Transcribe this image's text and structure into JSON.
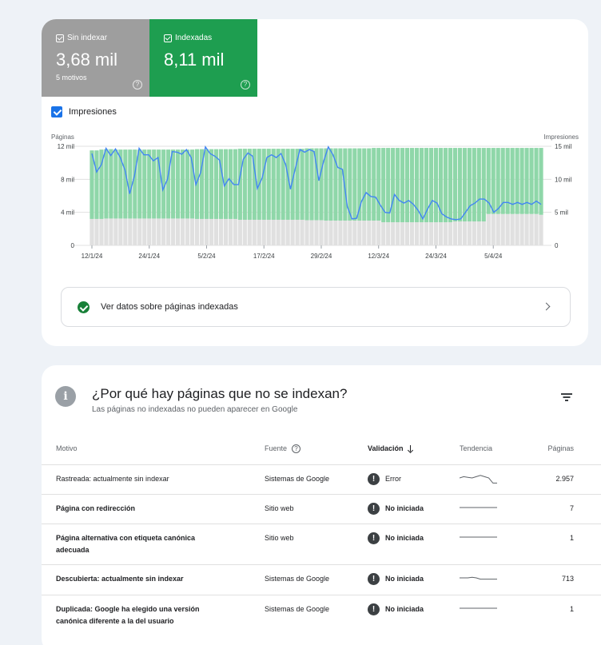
{
  "summary": {
    "not_indexed": {
      "label": "Sin indexar",
      "value": "3,68 mil",
      "sub": "5 motivos",
      "color": "#9e9e9e"
    },
    "indexed": {
      "label": "Indexadas",
      "value": "8,11 mil",
      "color": "#1e9e50"
    },
    "help_glyph": "?"
  },
  "impressions_toggle": {
    "label": "Impresiones",
    "checked": true
  },
  "chart_data": {
    "type": "bar",
    "stacked": true,
    "left_axis_label": "Páginas",
    "right_axis_label": "Impresiones",
    "left_ticks": [
      "12 mil",
      "8 mil",
      "4 mil",
      "0"
    ],
    "right_ticks": [
      "15 mil",
      "10 mil",
      "5 mil",
      "0"
    ],
    "left_ylim": [
      0,
      12000
    ],
    "right_ylim": [
      0,
      15000
    ],
    "x_tick_labels": [
      "12/1/24",
      "24/1/24",
      "5/2/24",
      "17/2/24",
      "29/2/24",
      "12/3/24",
      "24/3/24",
      "5/4/24"
    ],
    "x_tick_index": [
      0,
      12,
      24,
      36,
      48,
      60,
      72,
      84
    ],
    "grid": true,
    "series": [
      {
        "name": "Sin indexar",
        "color": "#e0e0e0",
        "values": [
          3200,
          3200,
          3200,
          3250,
          3250,
          3250,
          3250,
          3250,
          3250,
          3250,
          3250,
          3250,
          3250,
          3250,
          3250,
          3250,
          3250,
          3250,
          3250,
          3250,
          3250,
          3250,
          3200,
          3200,
          3200,
          3200,
          3200,
          3200,
          3200,
          3200,
          3200,
          3100,
          3100,
          3100,
          3100,
          3100,
          3100,
          3100,
          3100,
          3100,
          3100,
          3100,
          3100,
          3100,
          3100,
          3050,
          3050,
          3050,
          3050,
          3000,
          3000,
          3000,
          3000,
          3000,
          3000,
          3000,
          3000,
          3000,
          3000,
          3000,
          3000,
          2800,
          2800,
          2800,
          2800,
          2800,
          2800,
          2800,
          2800,
          2800,
          2800,
          2800,
          2800,
          2800,
          2800,
          2800,
          2900,
          2900,
          2900,
          2900,
          2900,
          2900,
          2900,
          3800,
          3800,
          3800,
          3800,
          3800,
          3800,
          3800,
          3800,
          3800,
          3800,
          3800,
          3700
        ]
      },
      {
        "name": "Indexadas",
        "color": "#8fd7a9",
        "values": [
          8300,
          8300,
          8400,
          8400,
          8400,
          8350,
          8350,
          8350,
          8350,
          8350,
          8350,
          8350,
          8350,
          8350,
          8350,
          8350,
          8350,
          8350,
          8350,
          8350,
          8350,
          8350,
          8450,
          8450,
          8450,
          8450,
          8450,
          8450,
          8450,
          8450,
          8450,
          8600,
          8600,
          8600,
          8600,
          8600,
          8600,
          8600,
          8600,
          8600,
          8600,
          8600,
          8600,
          8600,
          8600,
          8700,
          8700,
          8700,
          8700,
          8750,
          8750,
          8750,
          8750,
          8750,
          8750,
          8750,
          8750,
          8750,
          8750,
          8800,
          8800,
          9000,
          9000,
          9000,
          9000,
          9000,
          9000,
          9000,
          9000,
          9000,
          9000,
          9000,
          9000,
          9000,
          9000,
          9000,
          8900,
          8900,
          8900,
          8900,
          8900,
          8900,
          8900,
          8000,
          8000,
          8000,
          8000,
          8000,
          8000,
          8000,
          8000,
          8000,
          8000,
          8000,
          8100
        ]
      }
    ],
    "line_series": {
      "name": "Impresiones",
      "color": "#4285f4",
      "axis": "right",
      "values": [
        13900,
        11100,
        12200,
        14700,
        13600,
        14600,
        13300,
        11400,
        7800,
        10500,
        14700,
        13700,
        13700,
        12800,
        13300,
        8400,
        10000,
        14200,
        14100,
        13800,
        14500,
        13300,
        9200,
        11000,
        14900,
        13900,
        13500,
        12900,
        9000,
        10100,
        9200,
        9200,
        13000,
        14000,
        13500,
        8600,
        10200,
        13300,
        13700,
        13300,
        13900,
        12200,
        8500,
        11600,
        14500,
        14100,
        14500,
        14200,
        9800,
        12700,
        14900,
        13700,
        11800,
        11500,
        5900,
        4000,
        4100,
        6600,
        8000,
        7400,
        7300,
        6100,
        5000,
        4900,
        7700,
        6800,
        6400,
        6800,
        6200,
        5300,
        4000,
        5500,
        6800,
        6400,
        4800,
        4300,
        4000,
        3900,
        4000,
        5000,
        6000,
        6400,
        7000,
        7000,
        6400,
        5000,
        5600,
        6500,
        6500,
        6200,
        6500,
        6200,
        6500,
        6200,
        6700,
        6200
      ]
    }
  },
  "view_indexed": {
    "label": "Ver datos sobre páginas indexadas"
  },
  "reasons": {
    "title": "¿Por qué hay páginas que no se indexan?",
    "subtitle": "Las páginas no indexadas no pueden aparecer en Google",
    "columns": {
      "reason": "Motivo",
      "source": "Fuente",
      "validation": "Validación",
      "trend": "Tendencia",
      "pages": "Páginas"
    },
    "rows": [
      {
        "reason": "Rastreada: actualmente sin indexar",
        "source": "Sistemas de Google",
        "validation": "Error",
        "pages": "2.957",
        "bold": false,
        "trend": [
          0.5,
          0.6,
          0.55,
          0.5,
          0.6,
          0.7,
          0.6,
          0.5,
          0.1,
          0.1
        ]
      },
      {
        "reason": "Página con redirección",
        "source": "Sitio web",
        "validation": "No iniciada",
        "pages": "7",
        "bold": true,
        "trend": [
          0.5,
          0.5,
          0.5,
          0.5,
          0.5,
          0.5,
          0.5,
          0.5,
          0.5,
          0.5
        ]
      },
      {
        "reason": "Página alternativa con etiqueta canónica adecuada",
        "source": "Sitio web",
        "validation": "No iniciada",
        "pages": "1",
        "bold": true,
        "trend": [
          0.5,
          0.5,
          0.5,
          0.5,
          0.5,
          0.5,
          0.5,
          0.5,
          0.5,
          0.5
        ]
      },
      {
        "reason": "Descubierta: actualmente sin indexar",
        "source": "Sistemas de Google",
        "validation": "No iniciada",
        "pages": "713",
        "bold": true,
        "trend": [
          0.5,
          0.5,
          0.5,
          0.55,
          0.5,
          0.4,
          0.4,
          0.4,
          0.4,
          0.4
        ]
      },
      {
        "reason": "Duplicada: Google ha elegido una versión canónica diferente a la del usuario",
        "source": "Sistemas de Google",
        "validation": "No iniciada",
        "pages": "1",
        "bold": true,
        "trend": [
          0.5,
          0.5,
          0.5,
          0.5,
          0.5,
          0.5,
          0.5,
          0.5,
          0.5,
          0.5
        ]
      }
    ],
    "status_glyph": "!",
    "info_glyph": "i"
  }
}
